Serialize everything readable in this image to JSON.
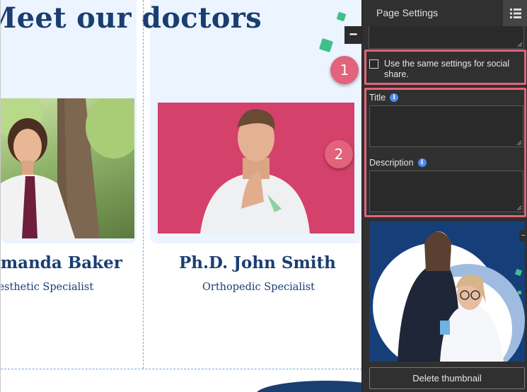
{
  "canvas": {
    "heading": "Meet our doctors",
    "doctors": [
      {
        "name": "Amanda Baker",
        "role": "Aesthetic Specialist"
      },
      {
        "name": "Ph.D. John Smith",
        "role": "Orthopedic Specialist"
      }
    ]
  },
  "callouts": [
    "1",
    "2"
  ],
  "panel": {
    "title": "Page Settings",
    "same_settings_label": "Use the same settings for social share.",
    "same_settings_checked": false,
    "title_label": "Title",
    "title_value": "",
    "description_label": "Description",
    "description_value": "",
    "delete_thumbnail": "Delete thumbnail",
    "thumbnail_close": "−",
    "info_glyph": "i"
  },
  "colors": {
    "heading": "#1a3e70",
    "card_bg": "#ebf4ff",
    "panel_bg": "#303030",
    "highlight": "#e2637b",
    "info": "#4d8cf0",
    "accent_green": "#3ec08a"
  },
  "icons": [
    "list-view-icon",
    "info-icon",
    "minus-icon",
    "checkbox-icon"
  ]
}
